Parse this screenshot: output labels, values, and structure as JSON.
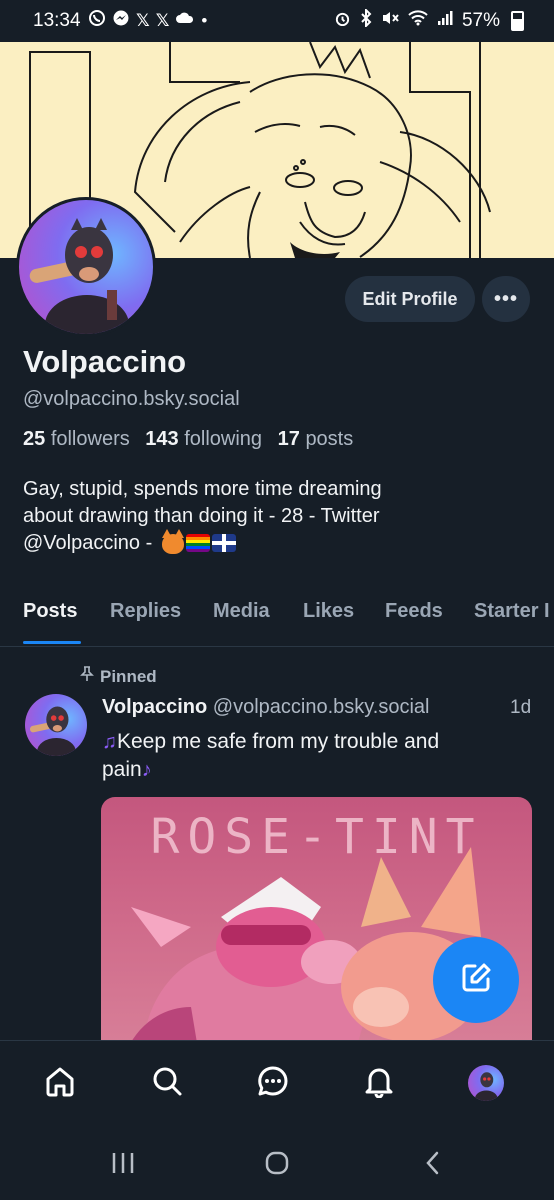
{
  "status_bar": {
    "time": "13:34",
    "left_icons": [
      "whatsapp-icon",
      "messenger-icon",
      "x-icon",
      "x-icon",
      "cloud-icon",
      "dot-icon"
    ],
    "right_icons": [
      "alarm-icon",
      "bluetooth-icon",
      "mute-icon",
      "wifi-icon",
      "signal-icon"
    ],
    "battery": "57%"
  },
  "profile": {
    "display_name": "Volpaccino",
    "handle": "@volpaccino.bsky.social",
    "edit_button": "Edit Profile",
    "more_button": "•••",
    "followers_count": "25",
    "followers_label": "followers",
    "following_count": "143",
    "following_label": "following",
    "posts_count": "17",
    "posts_label": "posts",
    "bio_line1": "Gay, stupid, spends more time dreaming",
    "bio_line2": "about drawing than doing it - 28 - Twitter",
    "bio_line3": "@Volpaccino - "
  },
  "tabs": [
    {
      "label": "Posts",
      "active": true
    },
    {
      "label": "Replies",
      "active": false
    },
    {
      "label": "Media",
      "active": false
    },
    {
      "label": "Likes",
      "active": false
    },
    {
      "label": "Feeds",
      "active": false
    },
    {
      "label": "Starter I",
      "active": false
    }
  ],
  "post": {
    "pinned_label": "Pinned",
    "author_name": "Volpaccino",
    "author_handle": "@volpaccino.bsky.social",
    "time": "1d",
    "text_line1": "Keep me safe from my trouble and",
    "text_line2": "pain",
    "image_title": "ROSE-TINT"
  },
  "bottom_nav": [
    "home-icon",
    "search-icon",
    "messages-icon",
    "notifications-icon",
    "profile-avatar"
  ],
  "colors": {
    "background": "#161e27",
    "accent": "#1b86f5",
    "muted_text": "#aeb8c4",
    "banner": "#fbefc2"
  }
}
